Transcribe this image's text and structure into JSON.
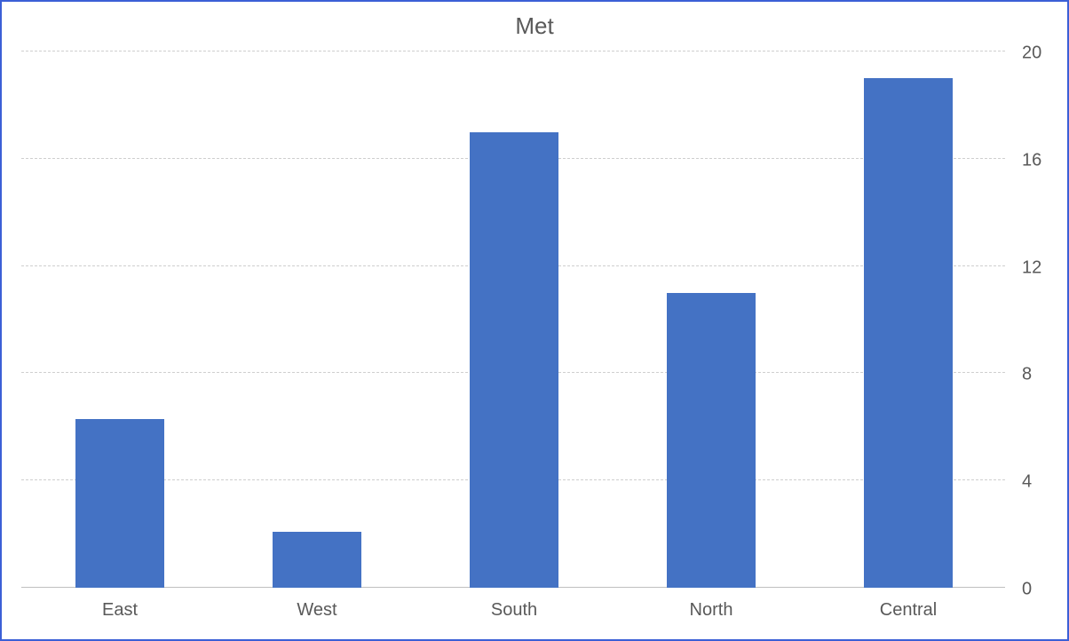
{
  "chart_data": {
    "type": "bar",
    "title": "Met",
    "categories": [
      "East",
      "West",
      "South",
      "North",
      "Central"
    ],
    "values": [
      6.3,
      2.1,
      17,
      11,
      19
    ],
    "ylim": [
      0,
      20
    ],
    "yticks": [
      0,
      4,
      8,
      12,
      16,
      20
    ],
    "bar_color": "#4472c4"
  }
}
